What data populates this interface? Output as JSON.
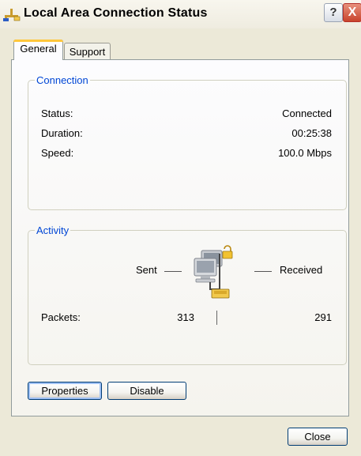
{
  "window": {
    "title": "Local Area Connection Status",
    "help_label": "?",
    "close_label": "X"
  },
  "tabs": [
    {
      "label": "General",
      "active": true
    },
    {
      "label": "Support",
      "active": false
    }
  ],
  "connection": {
    "legend": "Connection",
    "rows": [
      {
        "label": "Status:",
        "value": "Connected"
      },
      {
        "label": "Duration:",
        "value": "00:25:38"
      },
      {
        "label": "Speed:",
        "value": "100.0 Mbps"
      }
    ]
  },
  "activity": {
    "legend": "Activity",
    "sent_label": "Sent",
    "received_label": "Received",
    "packets_label": "Packets:",
    "packets_sent": "313",
    "packets_received": "291",
    "icon": "network-computers-icon"
  },
  "buttons": {
    "properties": "Properties",
    "disable": "Disable",
    "close": "Close"
  },
  "colors": {
    "window_bg": "#ece9d8",
    "legend_text": "#0046d5",
    "tab_highlight": "#ffc73c",
    "button_border": "#003c74"
  }
}
